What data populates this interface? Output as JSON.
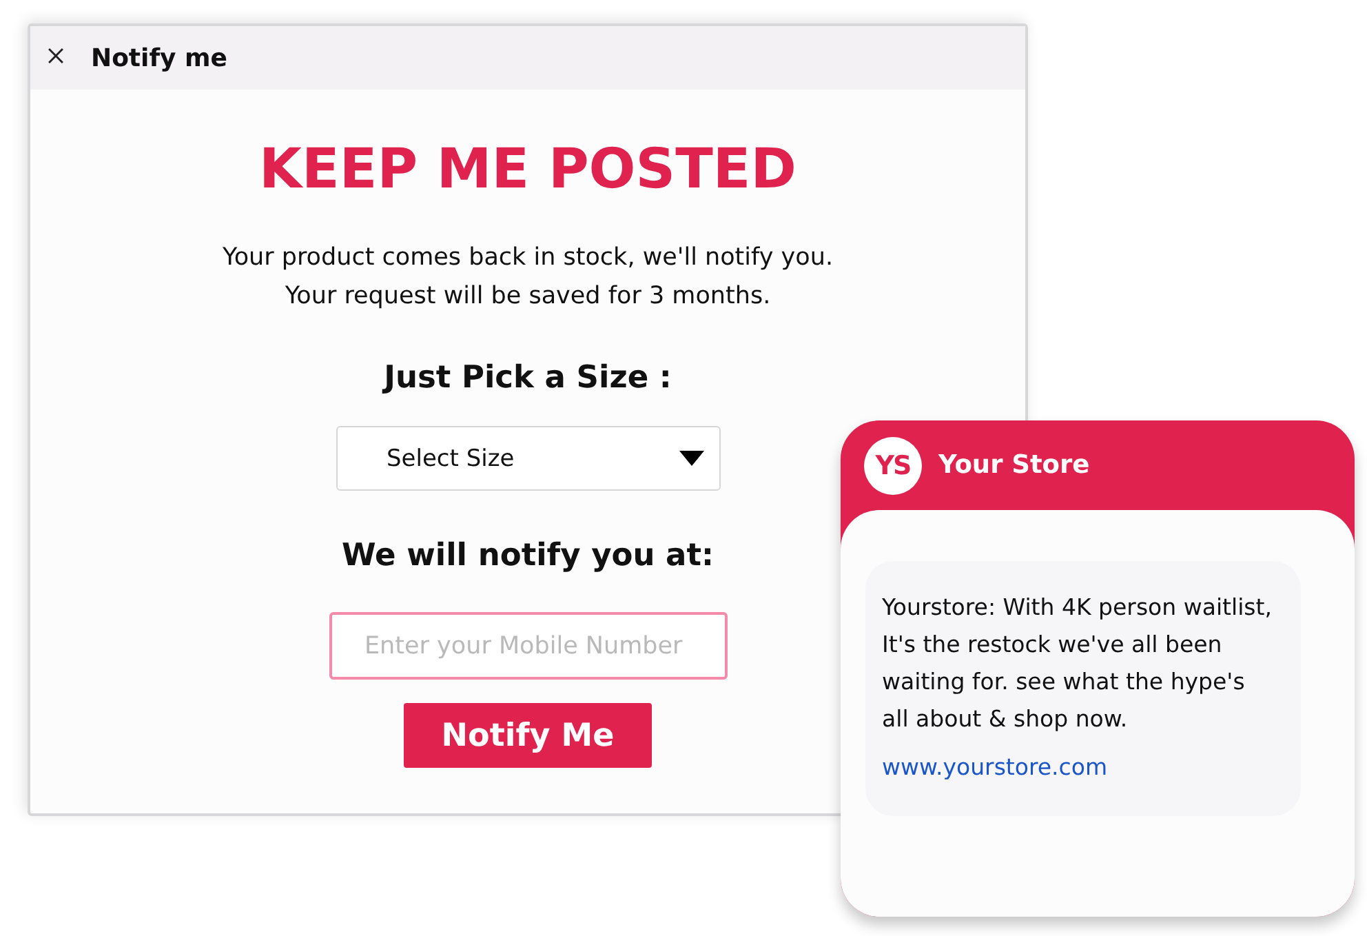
{
  "dialog": {
    "title": "Notify me",
    "heading": "KEEP ME POSTED",
    "message_lines": [
      "Your product comes back in stock, we'll notify you.",
      "Your request will be saved for 3 months."
    ],
    "size_label": "Just Pick a Size :",
    "size_select": {
      "value": "Select Size"
    },
    "notify_label": "We will notify you at:",
    "phone_field": {
      "placeholder": "Enter your Mobile Number"
    },
    "submit_button": "Notify Me"
  },
  "sms_preview": {
    "sender_initials": "YS",
    "sender_name": "Your Store",
    "message": "Yourstore: With 4K person waitlist, It's the restock we've all been waiting for. see what the hype's all about & shop now.",
    "link": "www.yourstore.com"
  }
}
